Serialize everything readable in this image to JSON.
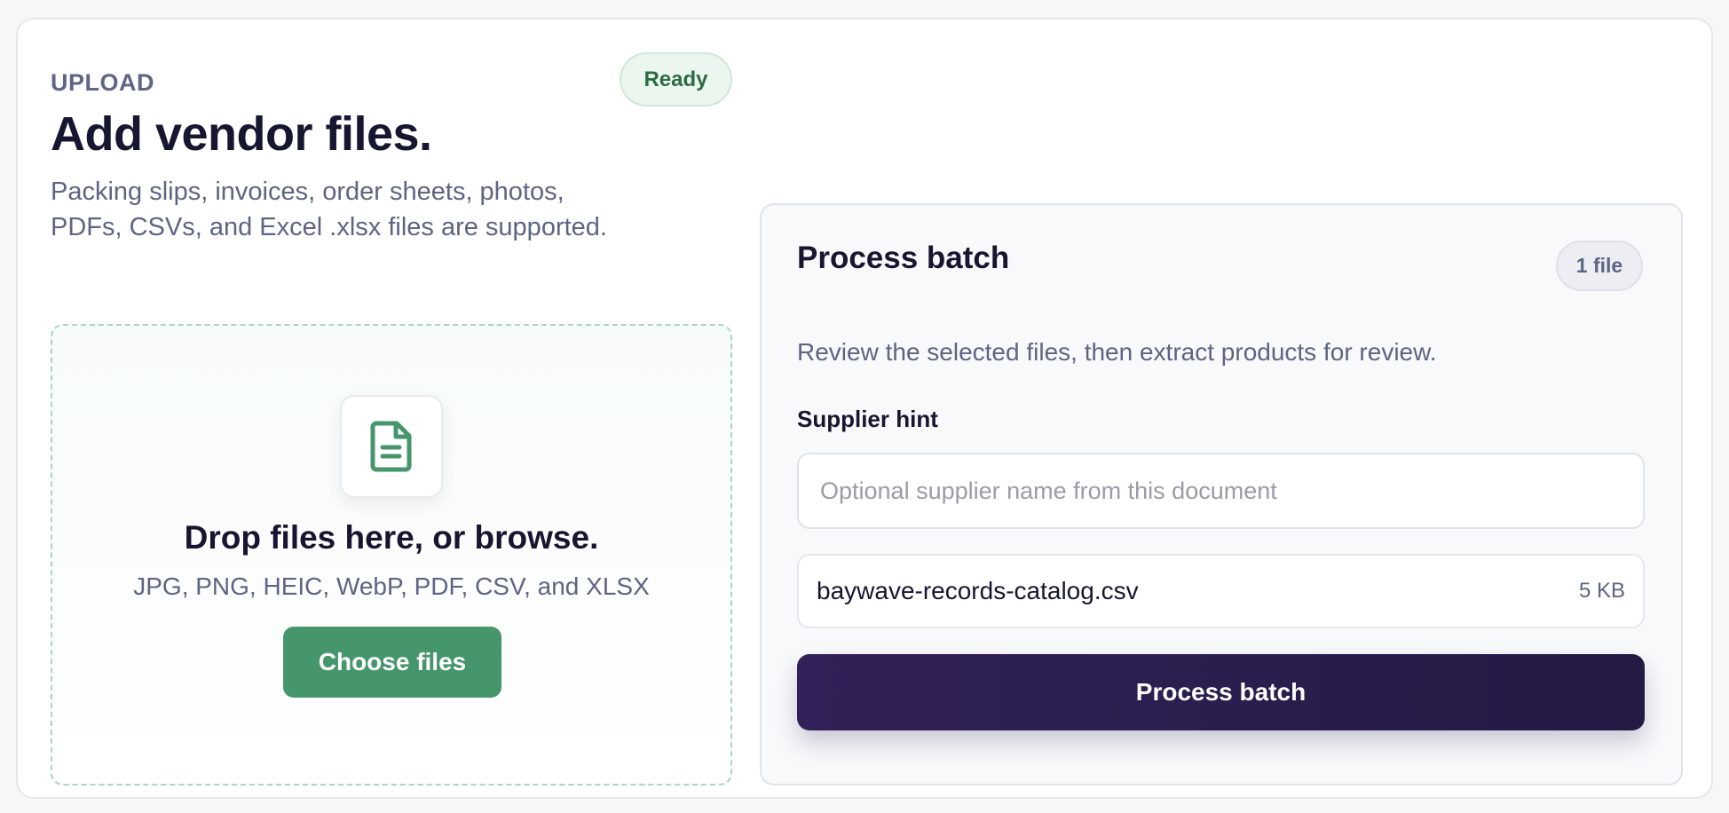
{
  "upload": {
    "eyebrow": "UPLOAD",
    "status_badge": "Ready",
    "title": "Add vendor files.",
    "subtitle": "Packing slips, invoices, order sheets, photos, PDFs, CSVs, and Excel .xlsx files are supported.",
    "dropzone": {
      "icon": "file-document-icon",
      "title": "Drop files here, or browse.",
      "formats": "JPG, PNG, HEIC, WebP, PDF, CSV, and XLSX",
      "button_label": "Choose files"
    }
  },
  "process_panel": {
    "title": "Process batch",
    "file_count_badge": "1 file",
    "description": "Review the selected files, then extract products for review.",
    "supplier_hint": {
      "label": "Supplier hint",
      "placeholder": "Optional supplier name from this document",
      "value": ""
    },
    "files": [
      {
        "name": "baywave-records-catalog.csv",
        "size": "5 KB"
      }
    ],
    "button_label": "Process batch"
  },
  "colors": {
    "accent_green": "#46966c",
    "primary_dark": "#2a1d50",
    "ready_badge_bg": "#eaf6ee",
    "ready_badge_text": "#2d6b45",
    "muted_text": "#5e6483"
  }
}
